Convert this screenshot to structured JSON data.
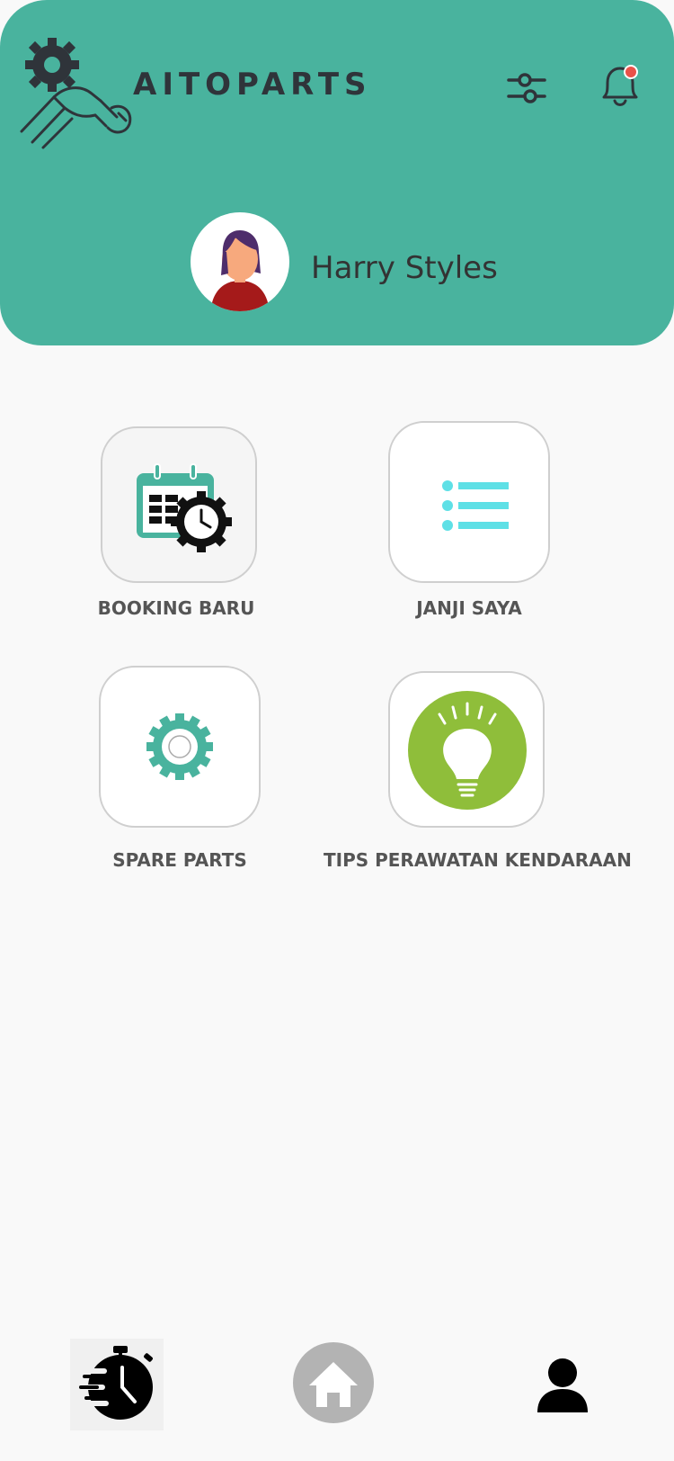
{
  "app": {
    "brand": "AITOPARTS"
  },
  "header": {
    "username": "Harry Styles"
  },
  "menu": [
    {
      "label": "BOOKING BARU",
      "icon": "calendar-gear-icon"
    },
    {
      "label": "JANJI SAYA",
      "icon": "list-icon"
    },
    {
      "label": "SPARE PARTS",
      "icon": "gear-icon"
    },
    {
      "label": "TIPS PERAWATAN KENDARAAN",
      "icon": "lightbulb-icon"
    }
  ],
  "bottom_nav": [
    {
      "icon": "history-clock-icon",
      "active": true
    },
    {
      "icon": "home-icon",
      "active": false
    },
    {
      "icon": "profile-icon",
      "active": false
    }
  ],
  "colors": {
    "header": "#49b39e",
    "accent_cyan": "#5ee0e6",
    "bulb_green": "#8fbe3a",
    "notification_dot": "#e9524a"
  }
}
